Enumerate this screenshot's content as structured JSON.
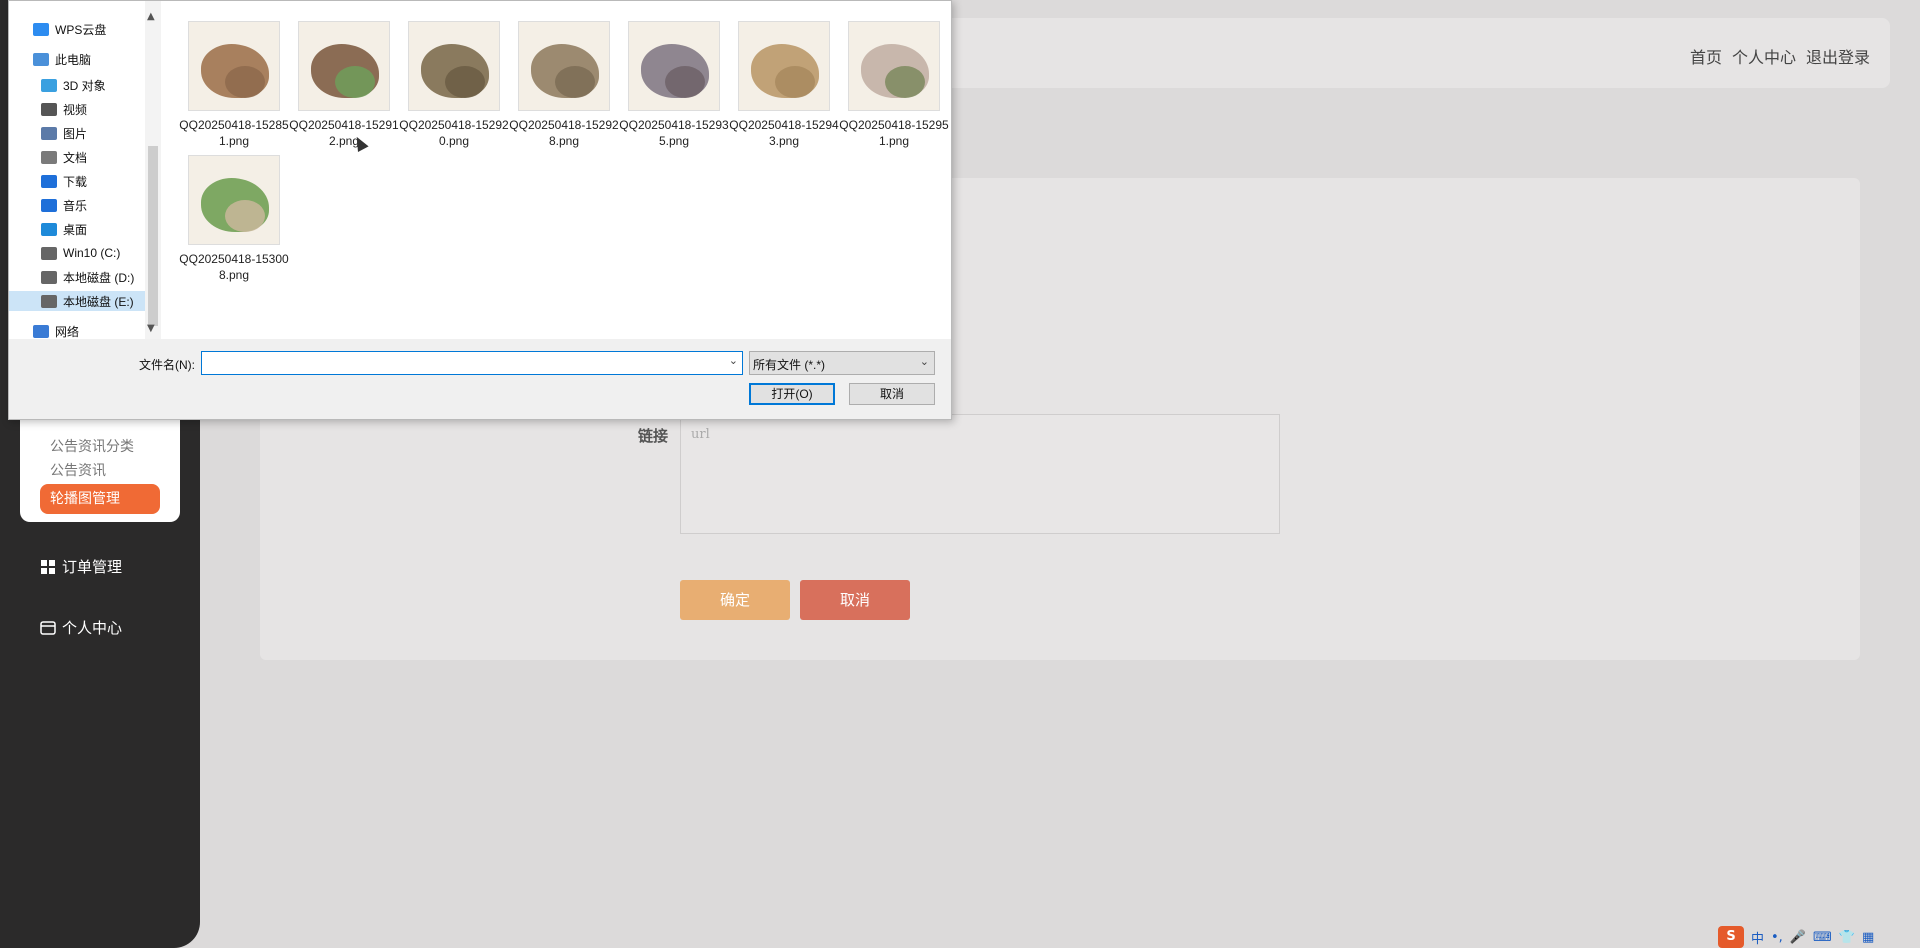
{
  "header": {
    "links": [
      "首页",
      "个人中心",
      "退出登录"
    ]
  },
  "sidebar": {
    "submenu": [
      "公告资讯分类",
      "公告资讯",
      "轮播图管理"
    ],
    "active_item": "轮播图管理",
    "nav": [
      {
        "label": "订单管理",
        "icon": "grid-icon"
      },
      {
        "label": "个人中心",
        "icon": "card-icon"
      }
    ]
  },
  "form": {
    "link_label": "链接",
    "link_placeholder": "url",
    "confirm_label": "确定",
    "cancel_label": "取消"
  },
  "file_dialog": {
    "nav_items": [
      {
        "label": "WPS云盘",
        "icon": "cloud-icon",
        "color": "#2d8cf0"
      },
      {
        "label": "此电脑",
        "icon": "computer-icon",
        "color": "#4a90d9"
      },
      {
        "label": "3D 对象",
        "icon": "cube-icon",
        "color": "#3aa0e0"
      },
      {
        "label": "视频",
        "icon": "video-icon",
        "color": "#555555"
      },
      {
        "label": "图片",
        "icon": "picture-icon",
        "color": "#5b7aa8"
      },
      {
        "label": "文档",
        "icon": "document-icon",
        "color": "#7a7a7a"
      },
      {
        "label": "下载",
        "icon": "download-icon",
        "color": "#1e6fd9"
      },
      {
        "label": "音乐",
        "icon": "music-icon",
        "color": "#1e6fd9"
      },
      {
        "label": "桌面",
        "icon": "desktop-icon",
        "color": "#1e8ad9"
      },
      {
        "label": "Win10 (C:)",
        "icon": "drive-icon",
        "color": "#666666"
      },
      {
        "label": "本地磁盘 (D:)",
        "icon": "drive-icon",
        "color": "#666666"
      },
      {
        "label": "本地磁盘 (E:)",
        "icon": "drive-icon",
        "color": "#666666"
      },
      {
        "label": "网络",
        "icon": "network-icon",
        "color": "#3a7bd5"
      }
    ],
    "selected_nav": "本地磁盘 (E:)",
    "files": [
      {
        "name": "QQ20250418-152851.png",
        "colors": [
          "#a8805e",
          "#8e6a4c"
        ]
      },
      {
        "name": "QQ20250418-152912.png",
        "colors": [
          "#8b6c54",
          "#6e9e5a"
        ]
      },
      {
        "name": "QQ20250418-152920.png",
        "colors": [
          "#8a7a5e",
          "#6b5d44"
        ]
      },
      {
        "name": "QQ20250418-152928.png",
        "colors": [
          "#9c8a70",
          "#7c6c55"
        ]
      },
      {
        "name": "QQ20250418-152935.png",
        "colors": [
          "#8f8690",
          "#6e6168"
        ]
      },
      {
        "name": "QQ20250418-152943.png",
        "colors": [
          "#c1a277",
          "#a88a5e"
        ]
      },
      {
        "name": "QQ20250418-152951.png",
        "colors": [
          "#c8b7ac",
          "#7c8a5e"
        ]
      },
      {
        "name": "QQ20250418-153008.png",
        "colors": [
          "#7ea863",
          "#c9b79a"
        ]
      }
    ],
    "filename_label": "文件名(N):",
    "filename_value": "",
    "filter_value": "所有文件 (*.*)",
    "open_label": "打开(O)",
    "cancel_label": "取消"
  },
  "tray": {
    "ime_label": "中",
    "logo": "S"
  }
}
